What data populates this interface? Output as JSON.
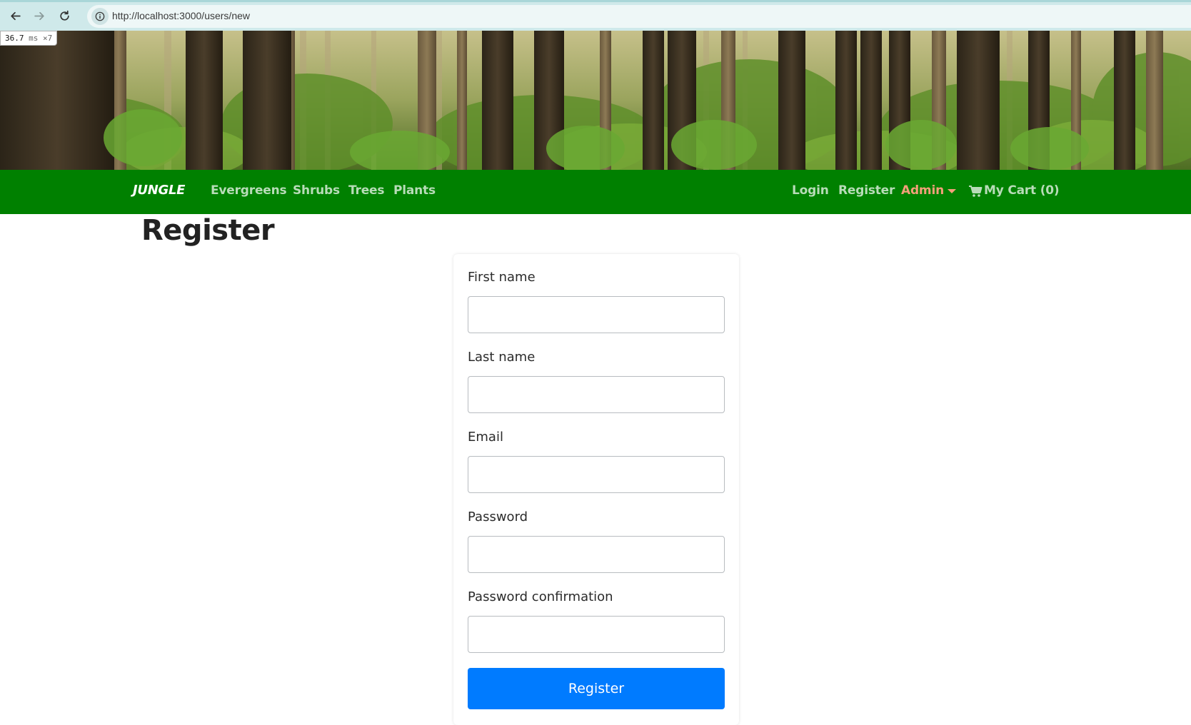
{
  "browser": {
    "url": "http://localhost:3000/users/new",
    "icons": [
      "back-arrow-icon",
      "forward-arrow-icon",
      "reload-icon",
      "site-info-icon"
    ]
  },
  "perf_badge": {
    "value": "36.7",
    "unit": "ms",
    "multiplier": "×7"
  },
  "hero": {
    "image": "forest-banner"
  },
  "navbar": {
    "brand": "JUNGLE",
    "categories": [
      {
        "label": "Evergreens"
      },
      {
        "label": "Shrubs"
      },
      {
        "label": "Trees"
      },
      {
        "label": "Plants"
      }
    ],
    "login": "Login",
    "register": "Register",
    "admin": "Admin",
    "cart": "My Cart (0)",
    "colors": {
      "background": "#008000",
      "link": "#b8dcb8",
      "admin": "#f4a07a",
      "brand": "#ffffff"
    }
  },
  "page": {
    "title": "Register"
  },
  "form": {
    "fields": [
      {
        "label": "First name",
        "value": ""
      },
      {
        "label": "Last name",
        "value": ""
      },
      {
        "label": "Email",
        "value": ""
      },
      {
        "label": "Password",
        "value": ""
      },
      {
        "label": "Password confirmation",
        "value": ""
      }
    ],
    "submit_label": "Register",
    "submit_color": "#007bff"
  }
}
